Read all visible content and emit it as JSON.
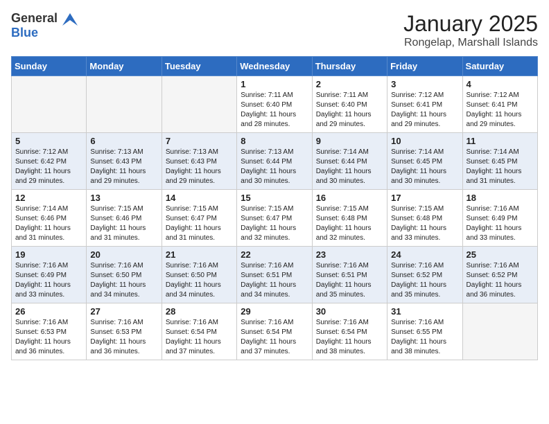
{
  "header": {
    "logo_general": "General",
    "logo_blue": "Blue",
    "month": "January 2025",
    "location": "Rongelap, Marshall Islands"
  },
  "days_of_week": [
    "Sunday",
    "Monday",
    "Tuesday",
    "Wednesday",
    "Thursday",
    "Friday",
    "Saturday"
  ],
  "weeks": [
    [
      {
        "day": "",
        "info": ""
      },
      {
        "day": "",
        "info": ""
      },
      {
        "day": "",
        "info": ""
      },
      {
        "day": "1",
        "info": "Sunrise: 7:11 AM\nSunset: 6:40 PM\nDaylight: 11 hours and 28 minutes."
      },
      {
        "day": "2",
        "info": "Sunrise: 7:11 AM\nSunset: 6:40 PM\nDaylight: 11 hours and 29 minutes."
      },
      {
        "day": "3",
        "info": "Sunrise: 7:12 AM\nSunset: 6:41 PM\nDaylight: 11 hours and 29 minutes."
      },
      {
        "day": "4",
        "info": "Sunrise: 7:12 AM\nSunset: 6:41 PM\nDaylight: 11 hours and 29 minutes."
      }
    ],
    [
      {
        "day": "5",
        "info": "Sunrise: 7:12 AM\nSunset: 6:42 PM\nDaylight: 11 hours and 29 minutes."
      },
      {
        "day": "6",
        "info": "Sunrise: 7:13 AM\nSunset: 6:43 PM\nDaylight: 11 hours and 29 minutes."
      },
      {
        "day": "7",
        "info": "Sunrise: 7:13 AM\nSunset: 6:43 PM\nDaylight: 11 hours and 29 minutes."
      },
      {
        "day": "8",
        "info": "Sunrise: 7:13 AM\nSunset: 6:44 PM\nDaylight: 11 hours and 30 minutes."
      },
      {
        "day": "9",
        "info": "Sunrise: 7:14 AM\nSunset: 6:44 PM\nDaylight: 11 hours and 30 minutes."
      },
      {
        "day": "10",
        "info": "Sunrise: 7:14 AM\nSunset: 6:45 PM\nDaylight: 11 hours and 30 minutes."
      },
      {
        "day": "11",
        "info": "Sunrise: 7:14 AM\nSunset: 6:45 PM\nDaylight: 11 hours and 31 minutes."
      }
    ],
    [
      {
        "day": "12",
        "info": "Sunrise: 7:14 AM\nSunset: 6:46 PM\nDaylight: 11 hours and 31 minutes."
      },
      {
        "day": "13",
        "info": "Sunrise: 7:15 AM\nSunset: 6:46 PM\nDaylight: 11 hours and 31 minutes."
      },
      {
        "day": "14",
        "info": "Sunrise: 7:15 AM\nSunset: 6:47 PM\nDaylight: 11 hours and 31 minutes."
      },
      {
        "day": "15",
        "info": "Sunrise: 7:15 AM\nSunset: 6:47 PM\nDaylight: 11 hours and 32 minutes."
      },
      {
        "day": "16",
        "info": "Sunrise: 7:15 AM\nSunset: 6:48 PM\nDaylight: 11 hours and 32 minutes."
      },
      {
        "day": "17",
        "info": "Sunrise: 7:15 AM\nSunset: 6:48 PM\nDaylight: 11 hours and 33 minutes."
      },
      {
        "day": "18",
        "info": "Sunrise: 7:16 AM\nSunset: 6:49 PM\nDaylight: 11 hours and 33 minutes."
      }
    ],
    [
      {
        "day": "19",
        "info": "Sunrise: 7:16 AM\nSunset: 6:49 PM\nDaylight: 11 hours and 33 minutes."
      },
      {
        "day": "20",
        "info": "Sunrise: 7:16 AM\nSunset: 6:50 PM\nDaylight: 11 hours and 34 minutes."
      },
      {
        "day": "21",
        "info": "Sunrise: 7:16 AM\nSunset: 6:50 PM\nDaylight: 11 hours and 34 minutes."
      },
      {
        "day": "22",
        "info": "Sunrise: 7:16 AM\nSunset: 6:51 PM\nDaylight: 11 hours and 34 minutes."
      },
      {
        "day": "23",
        "info": "Sunrise: 7:16 AM\nSunset: 6:51 PM\nDaylight: 11 hours and 35 minutes."
      },
      {
        "day": "24",
        "info": "Sunrise: 7:16 AM\nSunset: 6:52 PM\nDaylight: 11 hours and 35 minutes."
      },
      {
        "day": "25",
        "info": "Sunrise: 7:16 AM\nSunset: 6:52 PM\nDaylight: 11 hours and 36 minutes."
      }
    ],
    [
      {
        "day": "26",
        "info": "Sunrise: 7:16 AM\nSunset: 6:53 PM\nDaylight: 11 hours and 36 minutes."
      },
      {
        "day": "27",
        "info": "Sunrise: 7:16 AM\nSunset: 6:53 PM\nDaylight: 11 hours and 36 minutes."
      },
      {
        "day": "28",
        "info": "Sunrise: 7:16 AM\nSunset: 6:54 PM\nDaylight: 11 hours and 37 minutes."
      },
      {
        "day": "29",
        "info": "Sunrise: 7:16 AM\nSunset: 6:54 PM\nDaylight: 11 hours and 37 minutes."
      },
      {
        "day": "30",
        "info": "Sunrise: 7:16 AM\nSunset: 6:54 PM\nDaylight: 11 hours and 38 minutes."
      },
      {
        "day": "31",
        "info": "Sunrise: 7:16 AM\nSunset: 6:55 PM\nDaylight: 11 hours and 38 minutes."
      },
      {
        "day": "",
        "info": ""
      }
    ]
  ]
}
